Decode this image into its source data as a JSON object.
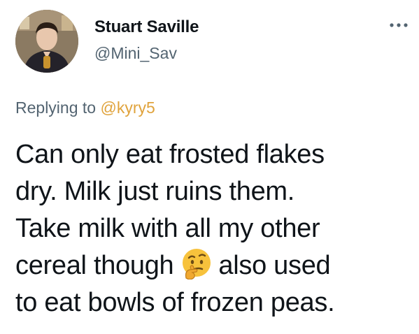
{
  "author": {
    "display_name": "Stuart Saville",
    "handle": "@Mini_Sav"
  },
  "menu": {
    "icon": "more-horizontal-icon"
  },
  "reply": {
    "prefix": "Replying to ",
    "mention": "@kyry5"
  },
  "tweet": {
    "line1": "Can only eat frosted flakes",
    "line2": "dry. Milk just ruins them.",
    "line3": "Take milk with all my other",
    "line4_before": "cereal though",
    "emoji": "thinking-face-emoji",
    "line4_after": "also used",
    "line5": "to eat bowls of frozen peas."
  },
  "colors": {
    "text": "#0f1419",
    "secondary": "#536471",
    "mention": "#e0a33c",
    "background": "#ffffff"
  }
}
